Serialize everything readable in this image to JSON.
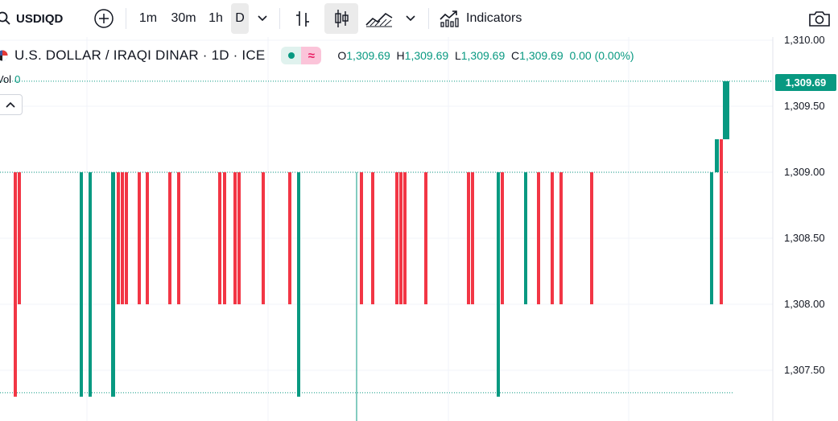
{
  "toolbar": {
    "symbol": "USDIQD",
    "intervals": [
      "1m",
      "30m",
      "1h",
      "D"
    ],
    "active_interval": "D",
    "indicators_label": "Indicators"
  },
  "legend": {
    "title": "U.S. DOLLAR / IRAQI DINAR · 1D · ICE",
    "pill_icon": "≈",
    "open_label": "O",
    "open": "1,309.69",
    "high_label": "H",
    "high": "1,309.69",
    "low_label": "L",
    "low": "1,309.69",
    "close_label": "C",
    "close": "1,309.69",
    "change": "0.00 (0.00%)"
  },
  "volume": {
    "label": "Vol",
    "value": "0"
  },
  "price_scale": {
    "labels": [
      "1,310.00",
      "1,309.50",
      "1,309.00",
      "1,308.50",
      "1,308.00",
      "1,307.50"
    ],
    "last_price": "1,309.69"
  },
  "colors": {
    "up": "#089981",
    "down": "#f23645",
    "grid": "#f0f3fa",
    "text": "#131722"
  },
  "chart_data": {
    "type": "bar",
    "symbol": "USDIQD",
    "interval": "1D",
    "ylim": [
      1307.32,
      1310.08
    ],
    "reference_levels": [
      1309.0,
      1309.69,
      1307.33
    ],
    "candles": [
      {
        "open": 1309.0,
        "close": 1307.3,
        "dir": "down"
      },
      {
        "open": 1308.0,
        "close": 1309.0,
        "dir": "down"
      },
      {
        "open": 1309.0,
        "close": 1307.3,
        "dir": "up"
      },
      {
        "open": 1309.0,
        "close": 1307.3,
        "dir": "up"
      },
      {
        "open": 1309.0,
        "close": 1307.3,
        "dir": "up"
      },
      {
        "open": 1309.0,
        "close": 1308.0,
        "dir": "down"
      },
      {
        "open": 1309.0,
        "close": 1308.0,
        "dir": "down"
      },
      {
        "open": 1309.0,
        "close": 1308.0,
        "dir": "down"
      },
      {
        "open": 1309.0,
        "close": 1308.0,
        "dir": "down"
      },
      {
        "open": 1309.0,
        "close": 1308.0,
        "dir": "down"
      },
      {
        "open": 1309.0,
        "close": 1308.0,
        "dir": "down"
      },
      {
        "open": 1309.0,
        "close": 1308.0,
        "dir": "down"
      },
      {
        "open": 1309.0,
        "close": 1308.0,
        "dir": "down"
      },
      {
        "open": 1309.0,
        "close": 1308.0,
        "dir": "down"
      },
      {
        "open": 1309.0,
        "close": 1308.0,
        "dir": "down"
      },
      {
        "open": 1309.0,
        "close": 1308.0,
        "dir": "down"
      },
      {
        "open": 1309.0,
        "close": 1308.0,
        "dir": "down"
      },
      {
        "open": 1309.0,
        "close": 1308.0,
        "dir": "down"
      },
      {
        "open": 1309.0,
        "close": 1307.3,
        "dir": "up"
      },
      {
        "open": 1309.0,
        "close": 1308.0,
        "dir": "down"
      },
      {
        "open": 1309.0,
        "close": 1308.0,
        "dir": "down"
      },
      {
        "open": 1309.0,
        "close": 1308.0,
        "dir": "down"
      },
      {
        "open": 1309.0,
        "close": 1308.0,
        "dir": "down"
      },
      {
        "open": 1309.0,
        "close": 1308.0,
        "dir": "down"
      },
      {
        "open": 1309.0,
        "close": 1308.0,
        "dir": "down"
      },
      {
        "open": 1309.0,
        "close": 1308.0,
        "dir": "down"
      },
      {
        "open": 1309.0,
        "close": 1308.0,
        "dir": "down"
      },
      {
        "open": 1309.0,
        "close": 1307.3,
        "dir": "up"
      },
      {
        "open": 1309.0,
        "close": 1308.0,
        "dir": "down"
      },
      {
        "open": 1309.0,
        "close": 1308.0,
        "dir": "up"
      },
      {
        "open": 1309.0,
        "close": 1308.0,
        "dir": "down"
      },
      {
        "open": 1309.0,
        "close": 1308.0,
        "dir": "down"
      },
      {
        "open": 1309.0,
        "close": 1308.0,
        "dir": "down"
      },
      {
        "open": 1309.0,
        "close": 1308.0,
        "dir": "down"
      },
      {
        "open": 1309.0,
        "close": 1308.0,
        "dir": "up"
      },
      {
        "open": 1309.0,
        "close": 1309.25,
        "dir": "up"
      },
      {
        "open": 1309.25,
        "close": 1308.0,
        "dir": "down"
      },
      {
        "open": 1309.25,
        "close": 1309.69,
        "dir": "up"
      },
      {
        "open": 1309.25,
        "close": 1309.69,
        "dir": "up"
      }
    ]
  }
}
